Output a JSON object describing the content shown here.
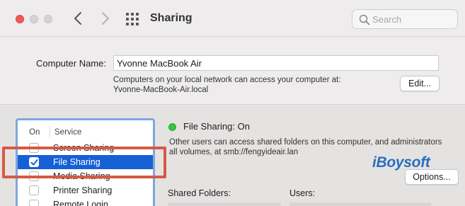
{
  "window": {
    "title": "Sharing",
    "traffic_lights": {
      "close_color": "#ee5b55",
      "inactive_color": "#d6d4d2"
    }
  },
  "toolbar": {
    "back_icon": "chevron-left-icon",
    "forward_icon": "chevron-right-icon",
    "grid_icon": "grid-icon",
    "search": {
      "placeholder": "Search",
      "value": ""
    }
  },
  "computer_name": {
    "label": "Computer Name:",
    "value": "Yvonne MacBook Air",
    "info_line1": "Computers on your local network can access your computer at:",
    "info_line2": "Yvonne-MacBook-Air.local",
    "edit_label": "Edit..."
  },
  "services": {
    "header_on": "On",
    "header_service": "Service",
    "items": [
      {
        "label": "Screen Sharing",
        "checked": false,
        "selected": false
      },
      {
        "label": "File Sharing",
        "checked": true,
        "selected": true
      },
      {
        "label": "Media Sharing",
        "checked": false,
        "selected": false
      },
      {
        "label": "Printer Sharing",
        "checked": false,
        "selected": false
      },
      {
        "label": "Remote Login",
        "checked": false,
        "selected": false
      }
    ]
  },
  "detail": {
    "status": "File Sharing: On",
    "status_color": "#38c43e",
    "description_line1": "Other users can access shared folders on this computer, and administrators",
    "description_line2": "all volumes, at smb://fengyideair.lan",
    "options_label": "Options...",
    "shared_folders_label": "Shared Folders:",
    "users_label": "Users:"
  },
  "watermark": "iBoysoft",
  "colors": {
    "selection": "#1660d6",
    "list_focus_border": "#7ea7e1",
    "highlight_box": "#d55a44",
    "watermark": "#2a6ec0"
  }
}
